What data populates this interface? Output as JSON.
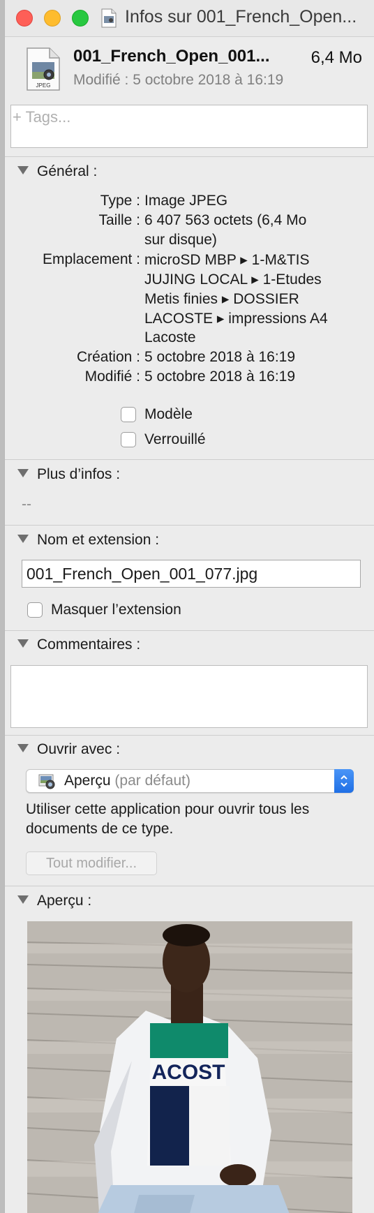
{
  "window": {
    "title": "Infos sur 001_French_Open..."
  },
  "header": {
    "file_name": "001_French_Open_001...",
    "file_size": "6,4 Mo",
    "modified_label": "Modifié :",
    "modified_value": "5 octobre 2018 à 16:19",
    "icon_badge": "JPEG"
  },
  "tags": {
    "placeholder": "+ Tags..."
  },
  "general": {
    "title": "Général :",
    "rows": [
      {
        "label": "Type :",
        "value": [
          "Image JPEG"
        ]
      },
      {
        "label": "Taille :",
        "value": [
          "6 407 563 octets (6,4 Mo",
          "sur disque)"
        ]
      },
      {
        "label": "Emplacement :",
        "value": [
          "microSD MBP ▸ 1-M&TIS",
          "JUJING LOCAL ▸ 1-Etudes",
          "Metis finies ▸ DOSSIER",
          "LACOSTE ▸ impressions A4",
          "Lacoste"
        ]
      },
      {
        "label": "Création :",
        "value": [
          "5 octobre 2018 à 16:19"
        ]
      },
      {
        "label": "Modifié :",
        "value": [
          "5 octobre 2018 à 16:19"
        ]
      }
    ],
    "checkbox_template": "Modèle",
    "checkbox_locked": "Verrouillé"
  },
  "more_info": {
    "title": "Plus d’infos :",
    "value": "--"
  },
  "name_ext": {
    "title": "Nom et extension :",
    "file_name": "001_French_Open_001_077.jpg",
    "hide_extension": "Masquer l’extension"
  },
  "comments": {
    "title": "Commentaires :"
  },
  "open_with": {
    "title": "Ouvrir avec :",
    "app": "Aperçu",
    "default_suffix": "(par défaut)",
    "help_text": "Utiliser cette application pour ouvrir tous les documents de ce type.",
    "change_all": "Tout modifier..."
  },
  "preview": {
    "title": "Aperçu :",
    "shirt_text": "ACOST"
  },
  "colors": {
    "close": "#fe5f57",
    "minimize": "#febc2e",
    "maximize": "#28c840",
    "accent": "#1f6fe5",
    "window_bg": "#ececec"
  }
}
